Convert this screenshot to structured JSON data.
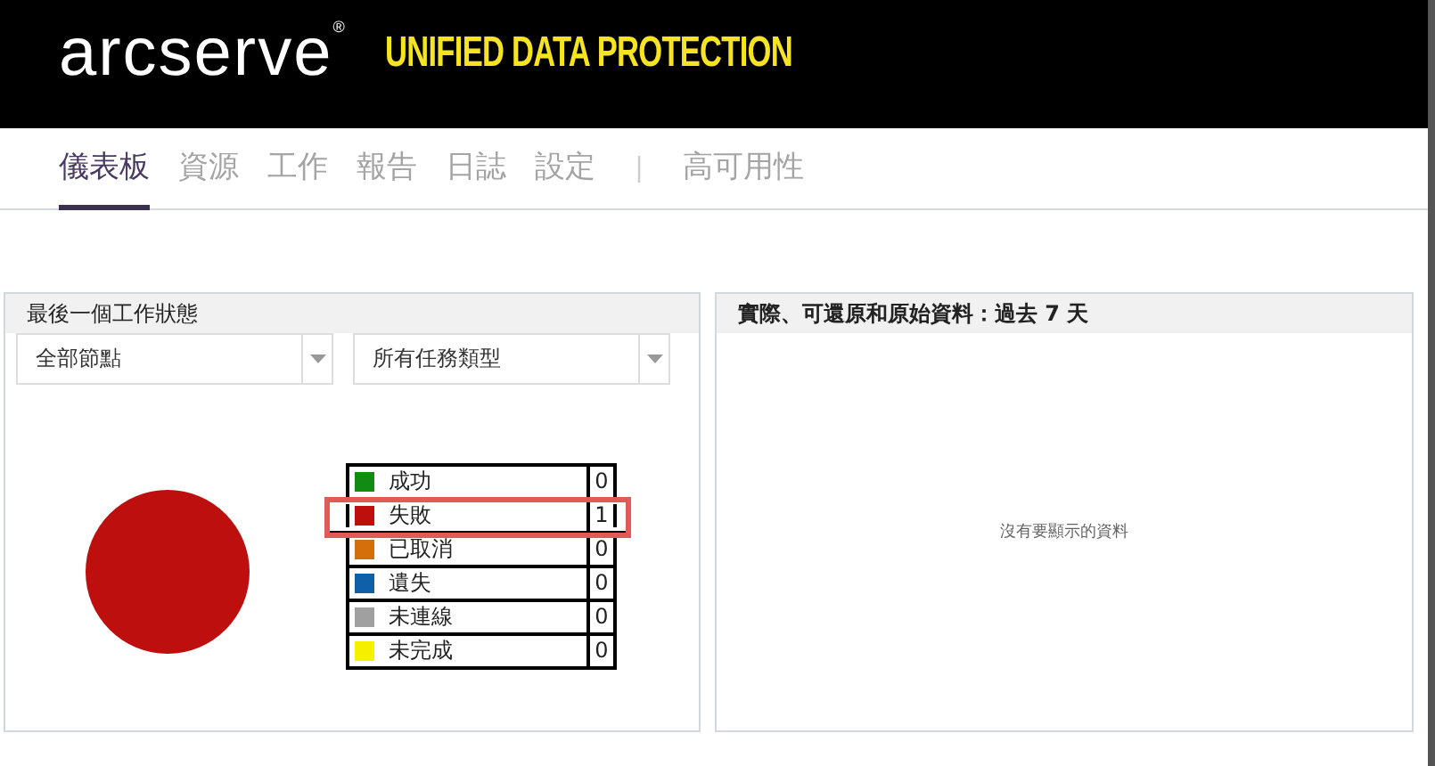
{
  "header": {
    "brand": "arcserve",
    "trademark": "®",
    "product": "UNIFIED DATA PROTECTION"
  },
  "nav": [
    {
      "label": "儀表板",
      "selected": true,
      "kind": "tab"
    },
    {
      "label": "資源",
      "selected": false,
      "kind": "tab"
    },
    {
      "label": "工作",
      "selected": false,
      "kind": "tab"
    },
    {
      "label": "報告",
      "selected": false,
      "kind": "tab"
    },
    {
      "label": "日誌",
      "selected": false,
      "kind": "tab"
    },
    {
      "label": "設定",
      "selected": false,
      "kind": "tab"
    },
    {
      "label": "|",
      "kind": "separator"
    },
    {
      "label": "高可用性",
      "selected": false,
      "kind": "tab"
    }
  ],
  "job_status_panel": {
    "title": "最後一個工作狀態",
    "node_filter": "全部節點",
    "job_type_filter": "所有任務類型",
    "legend": [
      {
        "label": "成功",
        "color": "#118c11",
        "count": "0",
        "highlighted": false
      },
      {
        "label": "失敗",
        "color": "#be0f0f",
        "count": "1",
        "highlighted": true
      },
      {
        "label": "已取消",
        "color": "#d4700a",
        "count": "0",
        "highlighted": false
      },
      {
        "label": "遺失",
        "color": "#1060a8",
        "count": "0",
        "highlighted": false
      },
      {
        "label": "未連線",
        "color": "#a0a0a0",
        "count": "0",
        "highlighted": false
      },
      {
        "label": "未完成",
        "color": "#f5f000",
        "count": "0",
        "highlighted": false
      }
    ]
  },
  "data_panel": {
    "title": "實際、可還原和原始資料：過去 7 天",
    "empty_message": "沒有要顯示的資料"
  }
}
